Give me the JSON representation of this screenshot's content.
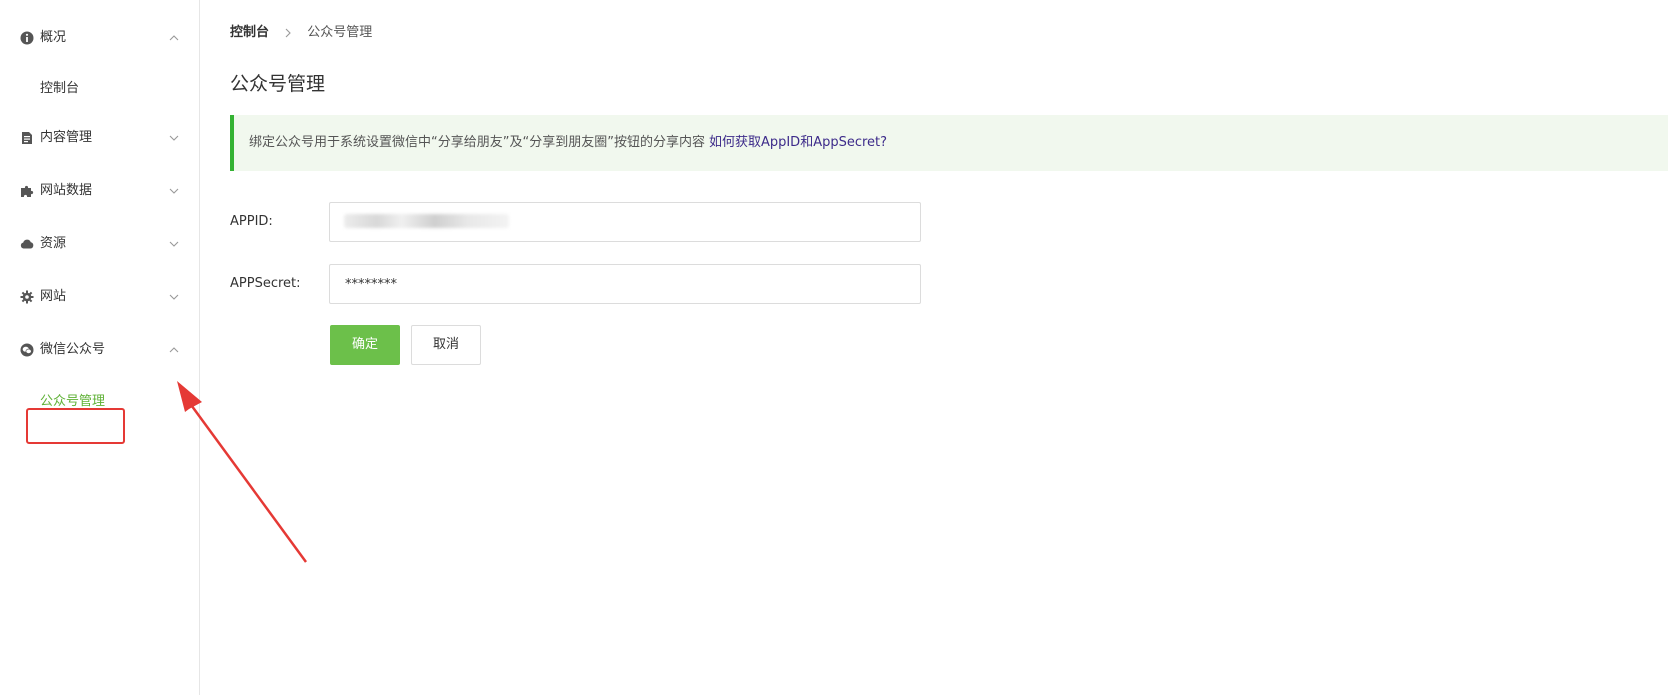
{
  "sidebar": {
    "groups": [
      {
        "label": "概况",
        "icon": "info-circle-icon",
        "expanded": true
      },
      {
        "label": "内容管理",
        "icon": "document-icon",
        "expanded": false
      },
      {
        "label": "网站数据",
        "icon": "puzzle-icon",
        "expanded": false
      },
      {
        "label": "资源",
        "icon": "cloud-icon",
        "expanded": false
      },
      {
        "label": "网站",
        "icon": "gear-icon",
        "expanded": false
      },
      {
        "label": "微信公众号",
        "icon": "wechat-icon",
        "expanded": true
      }
    ],
    "subitems": {
      "dashboard": "控制台",
      "official_account_mgmt": "公众号管理"
    },
    "active_color": "#5fb136"
  },
  "breadcrumb": {
    "root": "控制台",
    "current": "公众号管理"
  },
  "page_title": "公众号管理",
  "notice": {
    "text": "绑定公众号用于系统设置微信中“分享给朋友”及“分享到朋友圈”按钮的分享内容",
    "link": "如何获取AppID和AppSecret?",
    "accent_color": "#34b233",
    "background": "#f1f8ee"
  },
  "form": {
    "appid_label": "APPID:",
    "appid_value": "",
    "appsecret_label": "APPSecret:",
    "appsecret_value": "********"
  },
  "buttons": {
    "confirm": "确定",
    "cancel": "取消",
    "primary_color": "#6cc04a"
  },
  "annotation": {
    "color": "#e53935"
  }
}
